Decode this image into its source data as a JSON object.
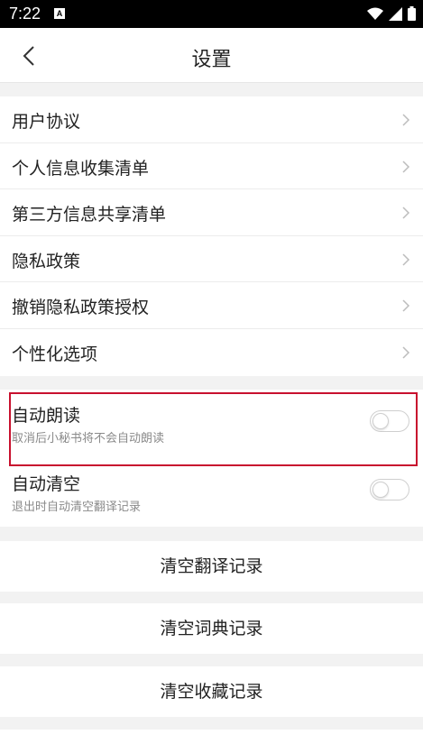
{
  "status_bar": {
    "time": "7:22",
    "notif_icon": "A"
  },
  "header": {
    "title": "设置"
  },
  "menu_items": [
    {
      "label": "用户协议"
    },
    {
      "label": "个人信息收集清单"
    },
    {
      "label": "第三方信息共享清单"
    },
    {
      "label": "隐私政策"
    },
    {
      "label": "撤销隐私政策授权"
    },
    {
      "label": "个性化选项"
    }
  ],
  "toggles": [
    {
      "label": "自动朗读",
      "description": "取消后小秘书将不会自动朗读",
      "on": false
    },
    {
      "label": "自动清空",
      "description": "退出时自动清空翻译记录",
      "on": false
    }
  ],
  "buttons": {
    "clear_translation": "清空翻译记录",
    "clear_dictionary": "清空词典记录",
    "clear_favorites": "清空收藏记录"
  },
  "colors": {
    "highlight": "#c8102e",
    "background": "#f2f2f2"
  }
}
